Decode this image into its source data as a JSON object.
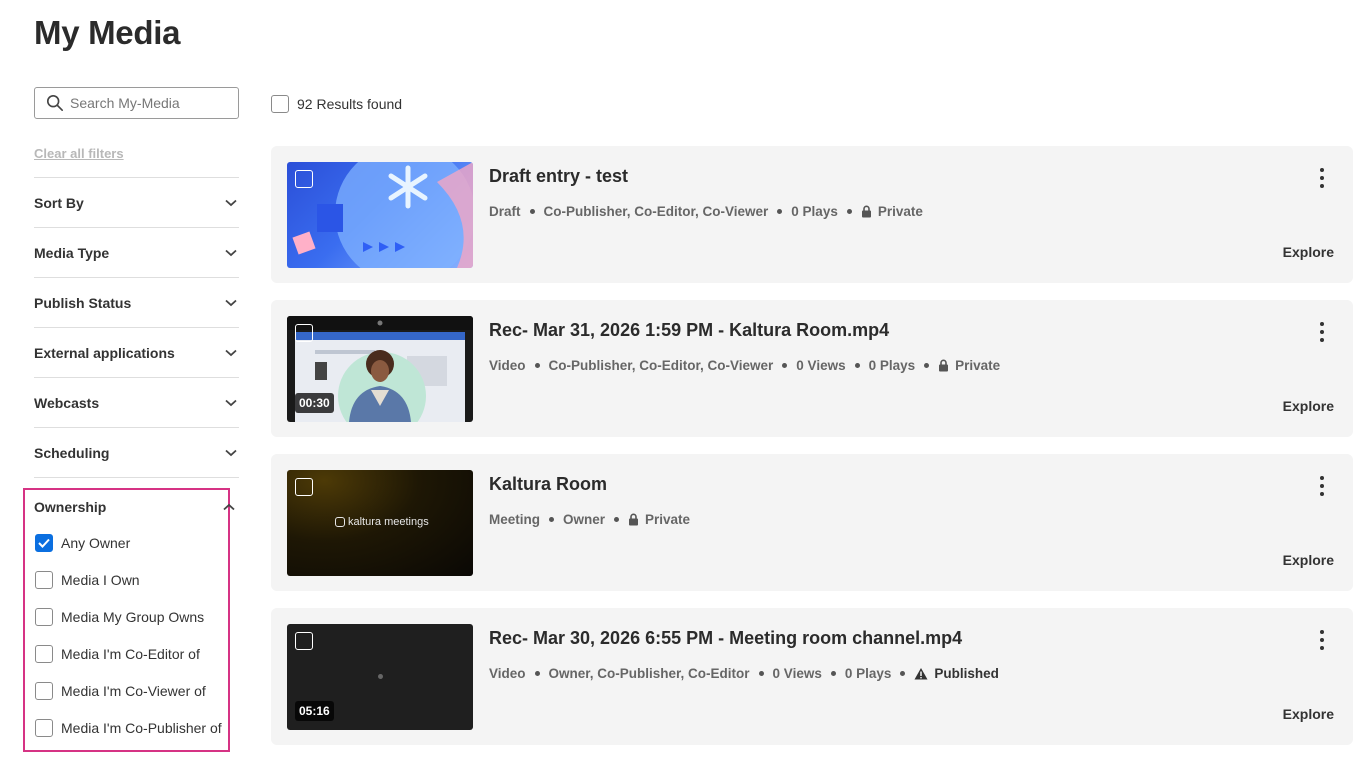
{
  "page": {
    "title": "My Media"
  },
  "sidebar": {
    "search_placeholder": "Search My-Media",
    "clear_filters": "Clear all filters",
    "filters": [
      {
        "label": "Sort By"
      },
      {
        "label": "Media Type"
      },
      {
        "label": "Publish Status"
      },
      {
        "label": "External applications"
      },
      {
        "label": "Webcasts"
      },
      {
        "label": "Scheduling"
      }
    ],
    "ownership": {
      "title": "Ownership",
      "options": [
        {
          "label": "Any Owner",
          "checked": true
        },
        {
          "label": "Media I Own",
          "checked": false
        },
        {
          "label": "Media My Group Owns",
          "checked": false
        },
        {
          "label": "Media I'm Co-Editor of",
          "checked": false
        },
        {
          "label": "Media I'm Co-Viewer of",
          "checked": false
        },
        {
          "label": "Media I'm Co-Publisher of",
          "checked": false
        }
      ]
    }
  },
  "results": {
    "count_text": "92 Results found"
  },
  "entries": [
    {
      "title": "Draft entry - test",
      "meta": [
        "Draft",
        "Co-Publisher, Co-Editor, Co-Viewer",
        "0 Plays"
      ],
      "status": "Private",
      "status_icon": "lock-icon",
      "duration": "",
      "explore": "Explore"
    },
    {
      "title": "Rec- Mar 31, 2026 1:59 PM - Kaltura Room.mp4",
      "meta": [
        "Video",
        "Co-Publisher, Co-Editor, Co-Viewer",
        "0 Views",
        "0 Plays"
      ],
      "status": "Private",
      "status_icon": "lock-icon",
      "duration": "00:30",
      "explore": "Explore"
    },
    {
      "title": "Kaltura Room",
      "meta": [
        "Meeting",
        "Owner"
      ],
      "status": "Private",
      "status_icon": "lock-icon",
      "duration": "",
      "thumb_logo": "kaltura meetings",
      "explore": "Explore"
    },
    {
      "title": "Rec- Mar 30, 2026 6:55 PM - Meeting room channel.mp4",
      "meta": [
        "Video",
        "Owner, Co-Publisher, Co-Editor",
        "0 Views",
        "0 Plays"
      ],
      "status": "Published",
      "status_icon": "warning-icon",
      "duration": "05:16",
      "explore": "Explore"
    }
  ],
  "colors": {
    "accent": "#0b6fe0",
    "highlight_border": "#d63384",
    "card_bg": "#f4f4f4"
  }
}
